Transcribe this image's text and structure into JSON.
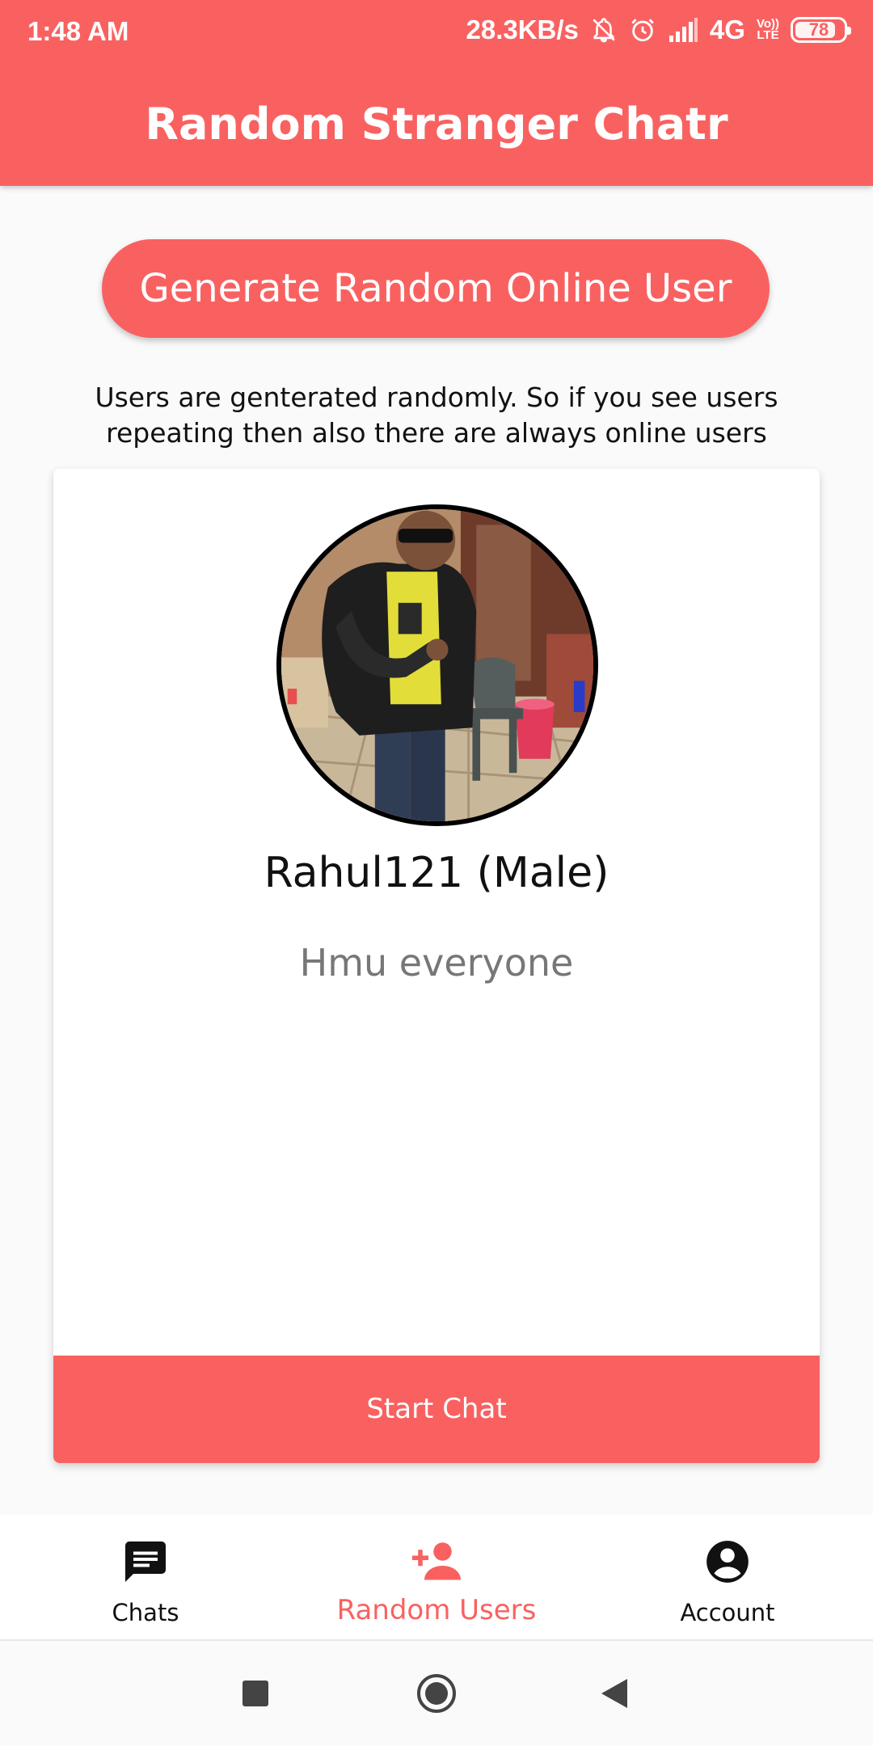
{
  "status_bar": {
    "time": "1:48 AM",
    "net_speed": "28.3KB/s",
    "network": "4G",
    "volte_top": "Vo))",
    "volte_bottom": "LTE",
    "battery": "78"
  },
  "header": {
    "title": "Random Stranger Chatr"
  },
  "main": {
    "generate_button": "Generate Random Online User",
    "note": "Users are genterated randomly. So if you see users repeating then also there are always online users"
  },
  "user_card": {
    "name": "Rahul121 (Male)",
    "status": "Hmu everyone",
    "start_chat": "Start Chat"
  },
  "bottom_nav": {
    "items": [
      {
        "label": "Chats",
        "icon": "chat-icon"
      },
      {
        "label": "Random Users",
        "icon": "person-add-icon"
      },
      {
        "label": "Account",
        "icon": "account-circle-icon"
      }
    ],
    "active": "Random Users"
  },
  "colors": {
    "accent": "#f96161",
    "muted_text": "#777777"
  }
}
